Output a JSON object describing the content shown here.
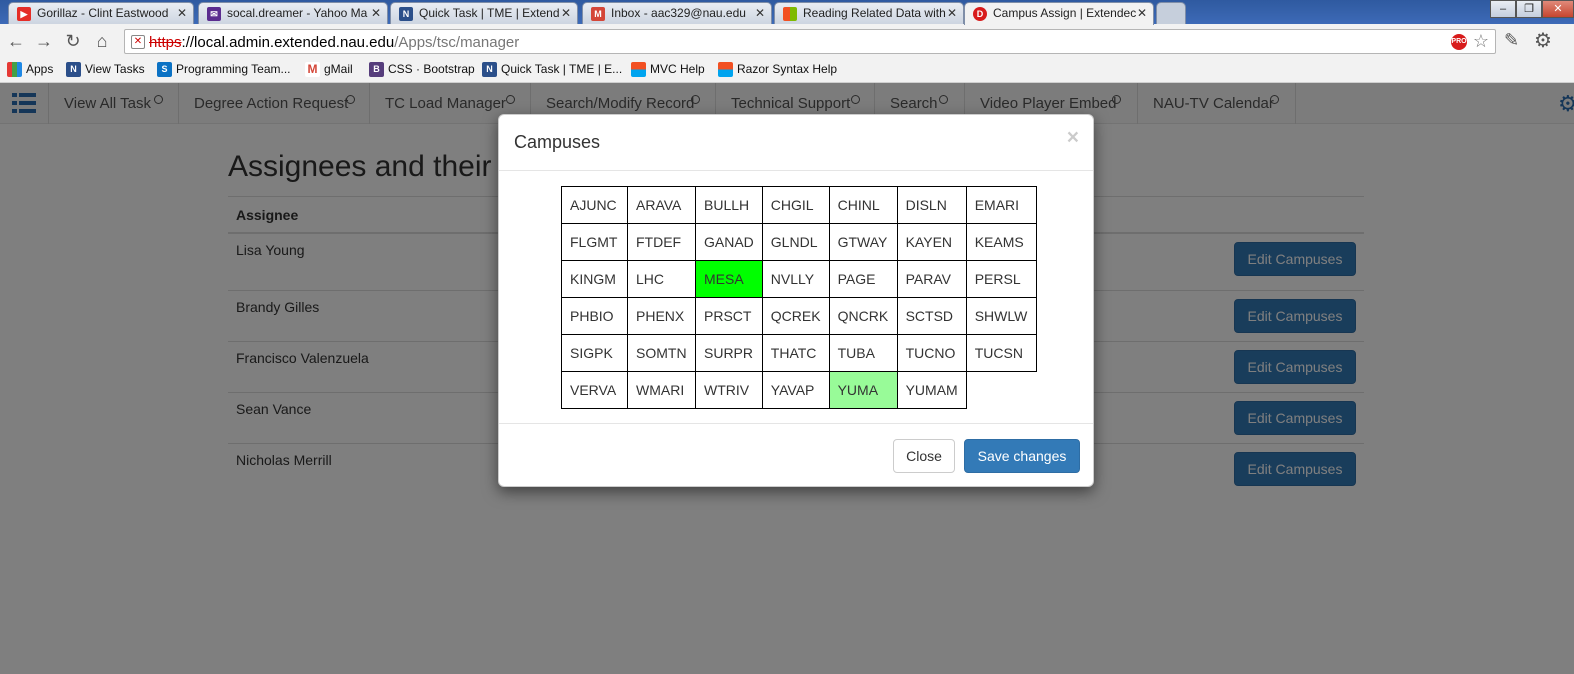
{
  "browser": {
    "tabs": [
      {
        "title": "Gorillaz - Clint Eastwood",
        "icon": "youtube-icon",
        "color": "#e52d27"
      },
      {
        "title": "socal.dreamer - Yahoo Ma",
        "icon": "yahoo-mail-icon",
        "color": "#5b2c8f"
      },
      {
        "title": "Quick Task | TME | Extend",
        "icon": "nau-icon",
        "color": "#2b4f8a"
      },
      {
        "title": "Inbox - aac329@nau.edu",
        "icon": "gmail-icon",
        "color": "#d44638"
      },
      {
        "title": "Reading Related Data with",
        "icon": "microsoft-icon",
        "color": "#f25022"
      },
      {
        "title": "Campus Assign | Extendec",
        "icon": "d-icon",
        "color": "#d81b1b",
        "active": true
      }
    ],
    "url": {
      "scheme": "https",
      "sep": "://",
      "host": "local.admin.extended.nau.edu",
      "path": "/Apps/tsc/manager"
    },
    "pro_badge": "PRO",
    "bookmarks": [
      {
        "label": "Apps",
        "icon": "apps-grid-icon"
      },
      {
        "label": "View Tasks",
        "icon": "nau-icon"
      },
      {
        "label": "Programming Team...",
        "icon": "sharepoint-icon"
      },
      {
        "label": "gMail",
        "icon": "gmail-icon"
      },
      {
        "label": "CSS · Bootstrap",
        "icon": "bootstrap-icon"
      },
      {
        "label": "Quick Task | TME | E...",
        "icon": "nau-icon"
      },
      {
        "label": "MVC Help",
        "icon": "microsoft-icon"
      },
      {
        "label": "Razor Syntax Help",
        "icon": "microsoft-icon"
      }
    ]
  },
  "app_nav": {
    "items": [
      "View All Task",
      "Degree Action Request",
      "TC Load Manager",
      "Search/Modify Record",
      "Technical Support",
      "Search",
      "Video Player Embed",
      "NAU-TV Calendar"
    ]
  },
  "main": {
    "title": "Assignees and their",
    "table_header": "Assignee",
    "assignees": [
      "Lisa Young",
      "Brandy Gilles",
      "Francisco Valenzuela",
      "Sean Vance",
      "Nicholas Merrill"
    ],
    "edit_label": "Edit Campuses"
  },
  "modal": {
    "title": "Campuses",
    "close_symbol": "×",
    "campuses": [
      [
        "AJUNC",
        "ARAVA",
        "BULLH",
        "CHGIL",
        "CHINL",
        "DISLN",
        "EMARI"
      ],
      [
        "FLGMT",
        "FTDEF",
        "GANAD",
        "GLNDL",
        "GTWAY",
        "KAYEN",
        "KEAMS"
      ],
      [
        "KINGM",
        "LHC",
        "MESA",
        "NVLLY",
        "PAGE",
        "PARAV",
        "PERSL"
      ],
      [
        "PHBIO",
        "PHENX",
        "PRSCT",
        "QCREK",
        "QNCRK",
        "SCTSD",
        "SHWLW"
      ],
      [
        "SIGPK",
        "SOMTN",
        "SURPR",
        "THATC",
        "TUBA",
        "TUCNO",
        "TUCSN"
      ],
      [
        "VERVA",
        "WMARI",
        "WTRIV",
        "YAVAP",
        "YUMA",
        "YUMAM",
        ""
      ]
    ],
    "selected_strong": "MESA",
    "selected_light": "YUMA",
    "close_label": "Close",
    "save_label": "Save changes"
  }
}
